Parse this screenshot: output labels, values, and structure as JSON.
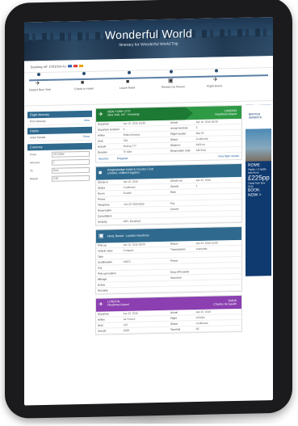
{
  "header": {
    "title": "Wonderful World",
    "subtitle": "Itinerary for Wonderful World Trip"
  },
  "subbar": {
    "reference": "Booking ref: 2781054-A1"
  },
  "timeline": [
    {
      "label": "Depart New York"
    },
    {
      "label": "Check-in Hotel"
    },
    {
      "label": "Leave Hotel"
    },
    {
      "label": "Rental Car Return"
    },
    {
      "label": "Flight Home"
    }
  ],
  "left": {
    "sections": [
      {
        "title": "Flight Itinerary",
        "rows": [
          {
            "k": "Print itinerary",
            "v": "View"
          }
        ]
      },
      {
        "title": "Hotels",
        "rows": [
          {
            "k": "Hotel Details",
            "v": "Show"
          }
        ]
      },
      {
        "title": "Currency",
        "fields": [
          {
            "k": "From",
            "v": "US Dollar"
          },
          {
            "k": "Amount",
            "v": "1"
          },
          {
            "k": "To",
            "v": "Euro"
          },
          {
            "k": "Result",
            "v": "0.92"
          }
        ]
      }
    ]
  },
  "cards": [
    {
      "color": "#2f9a45",
      "route": "NEW YORK CITY",
      "route_sub": "New York, NY - Kennedy",
      "dest": "LONDON",
      "dest_sub": "Heathrow Airport",
      "rows": [
        [
          "Departure",
          "Apr 15, 2016 18:30",
          "Arrival",
          "Apr 16, 2016 06:30"
        ],
        [
          "Departure terminal",
          "4",
          "Arrival terminal",
          "5"
        ],
        [
          "Airline",
          "British Airways",
          "Flight number",
          "BA178"
        ],
        [
          "Seat",
          "23A",
          "Status",
          "Confirmed"
        ],
        [
          "Aircraft",
          "Boeing 777",
          "Distance",
          "3459 mi"
        ],
        [
          "Duration",
          "7h 00m",
          "Reservation code",
          "AB7KX9"
        ]
      ],
      "links": [
        "Weather",
        "Baggage"
      ],
      "link_right": "View flight details"
    }
  ],
  "hotel": {
    "color": "#2f6a8e",
    "title": "Knightsbridge Hotel & Country Club",
    "sub": "London, United Kingdom",
    "rows": [
      [
        "Check-in",
        "Apr 16, 2016",
        "Check-out",
        "Apr 22, 2016"
      ],
      [
        "Status",
        "Confirmed",
        "Guests",
        "2"
      ],
      [
        "Room",
        "Double",
        "Rate",
        ""
      ],
      [
        "Phone",
        "",
        "",
        ""
      ],
      [
        "Telephone",
        "+44 20 7000 0000",
        "Fax",
        ""
      ],
      [
        "Reservation",
        "",
        "Cancel",
        ""
      ],
      [
        "Cancellation",
        "",
        "",
        ""
      ],
      [
        "Amenity",
        "WiFi, Breakfast",
        "",
        ""
      ]
    ]
  },
  "car": {
    "color": "#2f6a8e",
    "title": "Hertz Rental - London Heathrow",
    "rows": [
      [
        "Pick-up",
        "Apr 16, 2016 08:00",
        "Return",
        "Apr 22, 2016 10:00"
      ],
      [
        "Vehicle class",
        "Compact",
        "Transmission",
        "Automatic"
      ],
      [
        "Type",
        "",
        "",
        ""
      ],
      [
        "Confirmation",
        "H8371",
        "Phone",
        ""
      ],
      [
        "Fax",
        "",
        "",
        ""
      ],
      [
        "Pick-up location",
        "",
        "Drop-off location",
        ""
      ],
      [
        "Mileage",
        "",
        "Insurance",
        ""
      ],
      [
        "Extras",
        "",
        "",
        ""
      ],
      [
        "Remarks",
        "",
        "",
        ""
      ]
    ]
  },
  "return_flight": {
    "color": "#8b3fb0",
    "route": "LONDON",
    "route_sub": "Heathrow Airport",
    "dest": "PARIS",
    "dest_sub": "Charles de Gaulle",
    "rows": [
      [
        "Departure",
        "Apr 22, 2016",
        "Arrival",
        "Apr 22, 2016"
      ],
      [
        "Airline",
        "Air France",
        "Flight",
        "AF1681"
      ],
      [
        "Seat",
        "14C",
        "Status",
        "Confirmed"
      ],
      [
        "Aircraft",
        "A320",
        "Terminal",
        "2E"
      ]
    ]
  },
  "ad": {
    "brand": "BRITISH AIRWAYS",
    "city": "ROME",
    "line1": "Flights + 3 nights hotel from",
    "price": "£225pp",
    "line2": "Travel from Nov 2015",
    "cta": "BOOK NOW >"
  }
}
